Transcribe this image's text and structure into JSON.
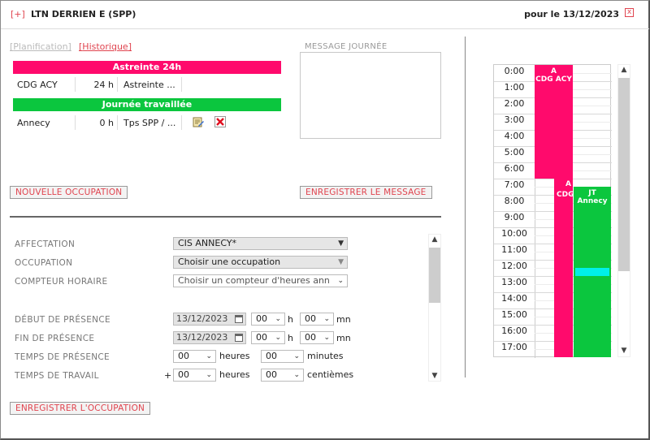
{
  "header": {
    "expand": "[+]",
    "title": "LTN DERRIEN E (SPP)",
    "date": "pour le 13/12/2023",
    "close": "x"
  },
  "tabs": {
    "planification": "Planification",
    "historique": "Historique"
  },
  "sections": [
    {
      "band": "Astreinte 24h",
      "color": "#ff0a6c",
      "place": "CDG ACY",
      "hours": "24 h",
      "type": "Astreinte ..."
    },
    {
      "band": "Journée travaillée",
      "color": "#0bc63e",
      "place": "Annecy",
      "hours": "0 h",
      "type": "Tps SPP / ..."
    }
  ],
  "message": {
    "label": "MESSAGE JOURNÉE",
    "value": ""
  },
  "buttons": {
    "nouvelle": "NOUVELLE OCCUPATION",
    "enregistrer_message": "ENREGISTRER LE MESSAGE",
    "enregistrer_occupation": "ENREGISTRER L'OCCUPATION"
  },
  "form": {
    "affectation": {
      "label": "AFFECTATION",
      "value": "CIS ANNECY*"
    },
    "occupation": {
      "label": "OCCUPATION",
      "value": "Choisir une occupation"
    },
    "compteur": {
      "label": "COMPTEUR HORAIRE",
      "value": "Choisir un compteur d'heures ann"
    },
    "debut": {
      "label": "DÉBUT DE PRÉSENCE",
      "date": "13/12/2023",
      "h": "00",
      "mn": "00"
    },
    "fin": {
      "label": "FIN DE PRÉSENCE",
      "date": "13/12/2023",
      "h": "00",
      "mn": "00"
    },
    "temps_presence": {
      "label": "TEMPS DE PRÉSENCE",
      "heures": "00",
      "minutes": "00"
    },
    "temps_travail": {
      "label": "TEMPS DE TRAVAIL",
      "sign": "+",
      "heures": "00",
      "centiemes": "00"
    },
    "units": {
      "h": "h",
      "mn": "mn",
      "heures": "heures",
      "minutes": "minutes",
      "centiemes": "centièmes"
    }
  },
  "timeline": {
    "hours": [
      "0:00",
      "1:00",
      "2:00",
      "3:00",
      "4:00",
      "5:00",
      "6:00",
      "7:00",
      "8:00",
      "9:00",
      "10:00",
      "11:00",
      "12:00",
      "13:00",
      "14:00",
      "15:00",
      "16:00",
      "17:00"
    ],
    "events": [
      {
        "label_line1": "A",
        "label_line2": "CDG ACY",
        "start": 0,
        "end": 7,
        "color": "#ff0a6c"
      },
      {
        "label_line1": "A",
        "label_line2": "CDG",
        "start": 7,
        "end": 18,
        "color": "#ff0a6c"
      },
      {
        "label_line1": "JT",
        "label_line2": "Annecy",
        "start": 7.5,
        "end": 18,
        "color": "#0bc63e"
      },
      {
        "label_line1": "",
        "label_line2": "",
        "start": 12.5,
        "end": 13,
        "color": "#00f0e8"
      }
    ]
  },
  "icons": {
    "edit": "edit-icon",
    "delete": "delete-icon",
    "calendar": "calendar-icon"
  }
}
